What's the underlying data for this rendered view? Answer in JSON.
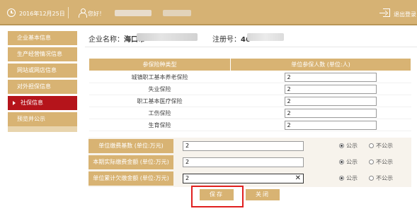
{
  "header": {
    "date": "2016年12月25日",
    "greeting": "您好！",
    "logout_label": "退出登录"
  },
  "sidebar": {
    "items": [
      {
        "label": "企业基本信息",
        "active": false
      },
      {
        "label": "生产经营情况信息",
        "active": false
      },
      {
        "label": "网站或网店信息",
        "active": false
      },
      {
        "label": "对外担保信息",
        "active": false
      },
      {
        "label": "社保信息",
        "active": true
      },
      {
        "label": "预览并公示",
        "active": false
      }
    ]
  },
  "company": {
    "name_label": "企业名称：",
    "name_value": "海口市",
    "reg_label": "注册号：",
    "reg_value": "46"
  },
  "insurance_table": {
    "headers": [
      "参保险种类型",
      "单位参保人数 (单位:人)"
    ],
    "rows": [
      {
        "type": "城镇职工基本养老保险",
        "value": "2"
      },
      {
        "type": "失业保险",
        "value": "2"
      },
      {
        "type": "职工基本医疗保险",
        "value": "2"
      },
      {
        "type": "工伤保险",
        "value": "2"
      },
      {
        "type": "生育保险",
        "value": "2"
      }
    ]
  },
  "payment": {
    "rows": [
      {
        "label": "单位缴费基数 (单位:万元)",
        "value": "2",
        "public": true
      },
      {
        "label": "本期实际缴费金额 (单位:万元)",
        "value": "2",
        "public": true
      },
      {
        "label": "单位累计欠缴金额 (单位:万元)",
        "value": "2",
        "public": true
      }
    ],
    "public_label": "公示",
    "not_public_label": "不公示"
  },
  "buttons": {
    "save_label": "保存",
    "close_label": "关闭"
  },
  "colors": {
    "header_bg": "#d6b274",
    "accent_gold": "#d8b373",
    "active_red": "#b5141b",
    "highlight_red": "#e02020"
  }
}
